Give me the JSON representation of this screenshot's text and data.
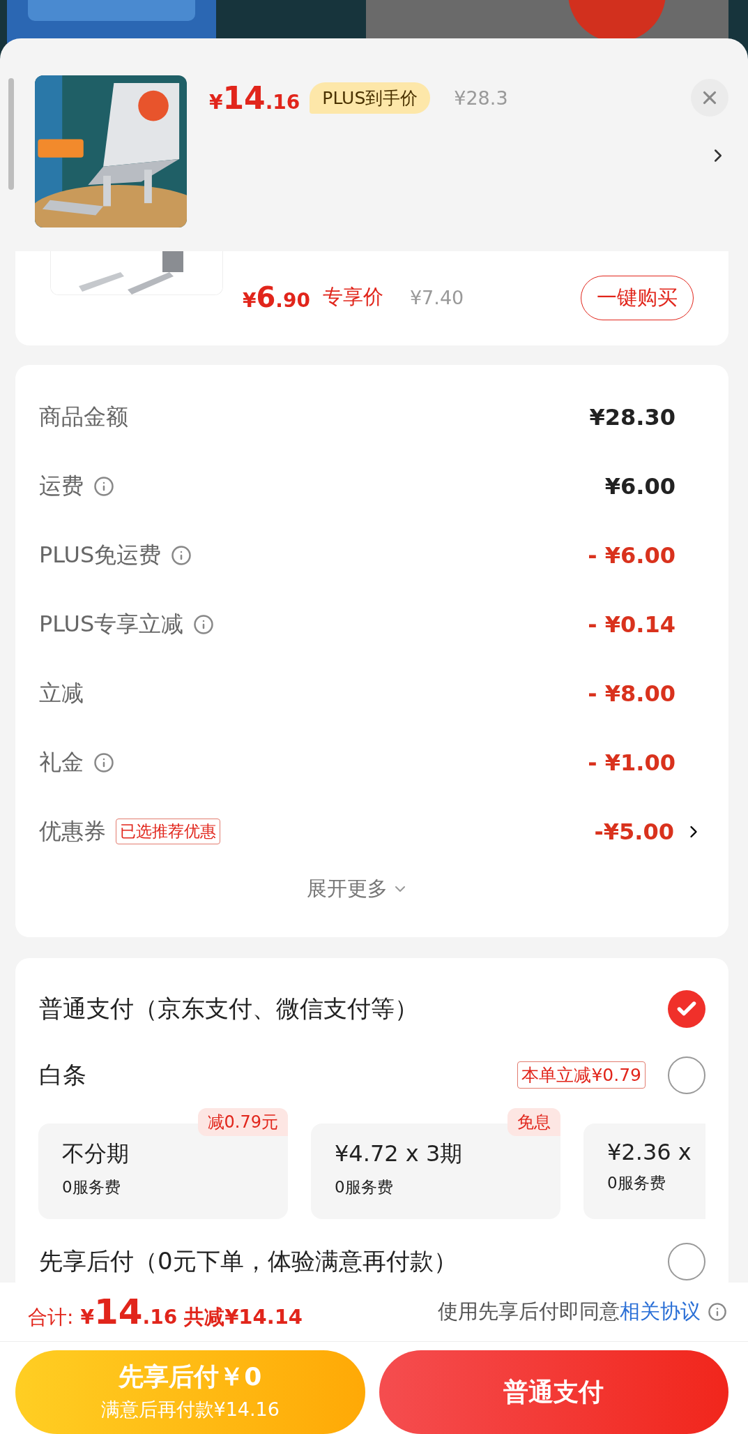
{
  "header": {
    "price": {
      "currency": "¥",
      "integer": "14",
      "decimal": ".16"
    },
    "price_tag": "PLUS到手价",
    "original_price": "¥28.3"
  },
  "addon": {
    "price": {
      "currency": "¥",
      "integer": "6",
      "decimal": ".90"
    },
    "price_label": "专享价",
    "original_price": "¥7.40",
    "button": "一键购买"
  },
  "summary": {
    "rows": [
      {
        "kind": "amount",
        "label": "商品金额",
        "value": "¥28.30",
        "info": false,
        "discount": false
      },
      {
        "kind": "amount",
        "label": "运费",
        "value": "¥6.00",
        "info": true,
        "discount": false
      },
      {
        "kind": "amount",
        "label": "PLUS免运费",
        "value": "- ¥6.00",
        "info": true,
        "discount": true
      },
      {
        "kind": "amount",
        "label": "PLUS专享立减",
        "value": "- ¥0.14",
        "info": true,
        "discount": true
      },
      {
        "kind": "amount",
        "label": "立减",
        "value": "- ¥8.00",
        "info": false,
        "discount": true
      },
      {
        "kind": "amount",
        "label": "礼金",
        "value": "- ¥1.00",
        "info": true,
        "discount": true
      },
      {
        "kind": "coupon",
        "label": "优惠券",
        "tag": "已选推荐优惠",
        "value": "-¥5.00",
        "info": false,
        "discount": true
      }
    ],
    "expand": "展开更多"
  },
  "payment": {
    "options": [
      {
        "label": "普通支付（京东支付、微信支付等）",
        "selected": true
      },
      {
        "label": "白条",
        "selected": false,
        "tag": "本单立减¥0.79",
        "installments": [
          {
            "title": "不分期",
            "fee": "0服务费",
            "badge": "减0.79元"
          },
          {
            "title": "¥4.72 x 3期",
            "fee": "0服务费",
            "badge": "免息"
          },
          {
            "title": "¥2.36 x",
            "fee": "0服务费"
          }
        ]
      },
      {
        "label": "先享后付（0元下单，体验满意再付款）",
        "selected": false
      }
    ]
  },
  "footer": {
    "total_label": "合计:",
    "total": {
      "currency": "¥",
      "integer": "14",
      "decimal": ".16"
    },
    "saved": "共减¥14.14",
    "agreement": "使用先享后付即同意",
    "agreement_link": "相关协议",
    "buttons": [
      {
        "kind": "later",
        "label": "先享后付￥0",
        "sub": "满意后再付款¥14.16"
      },
      {
        "kind": "pay",
        "label": "普通支付"
      }
    ]
  }
}
